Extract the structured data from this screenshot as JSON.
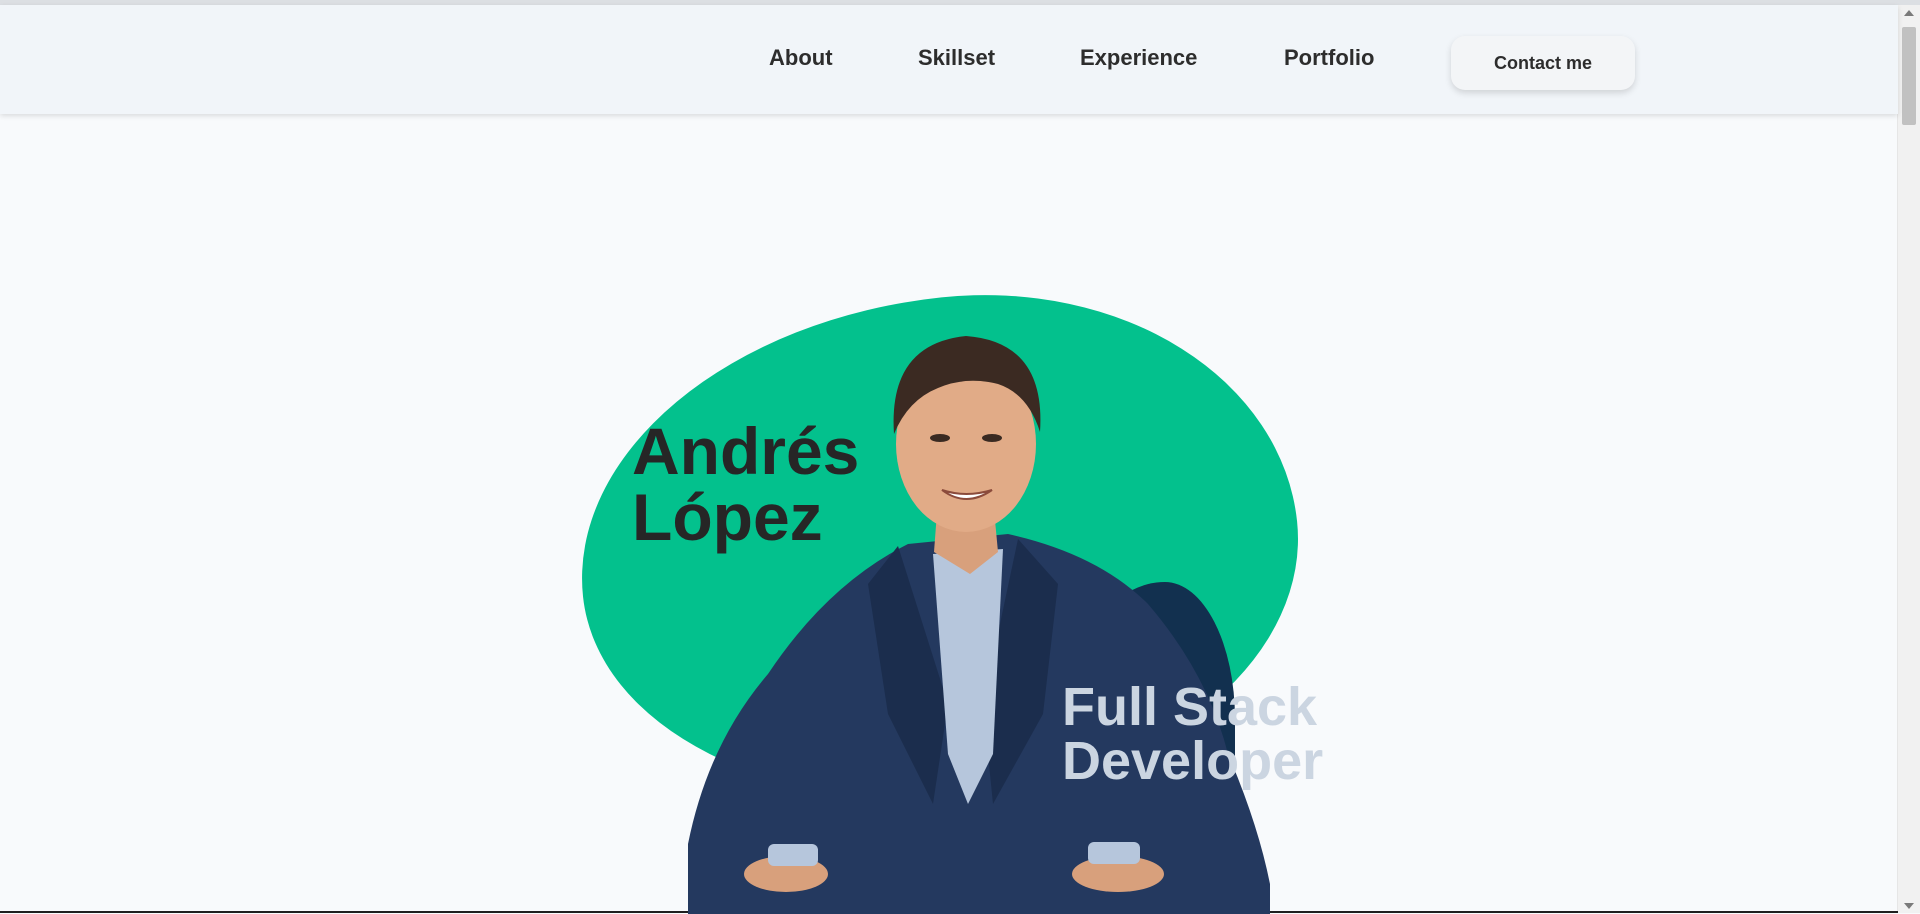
{
  "nav": {
    "links": [
      {
        "label": "About"
      },
      {
        "label": "Skillset"
      },
      {
        "label": "Experience"
      },
      {
        "label": "Portfolio"
      }
    ],
    "contact_label": "Contact me"
  },
  "hero": {
    "name_line1": "Andrés",
    "name_line2": "López",
    "role_line1": "Full Stack",
    "role_line2": "Developer"
  },
  "colors": {
    "accent_green": "#03c18d",
    "accent_navy": "#12304f",
    "role_text": "#cbd5e1",
    "name_text": "#262626"
  },
  "icons": {
    "scroll_up": "triangle-up",
    "scroll_down": "triangle-down"
  }
}
